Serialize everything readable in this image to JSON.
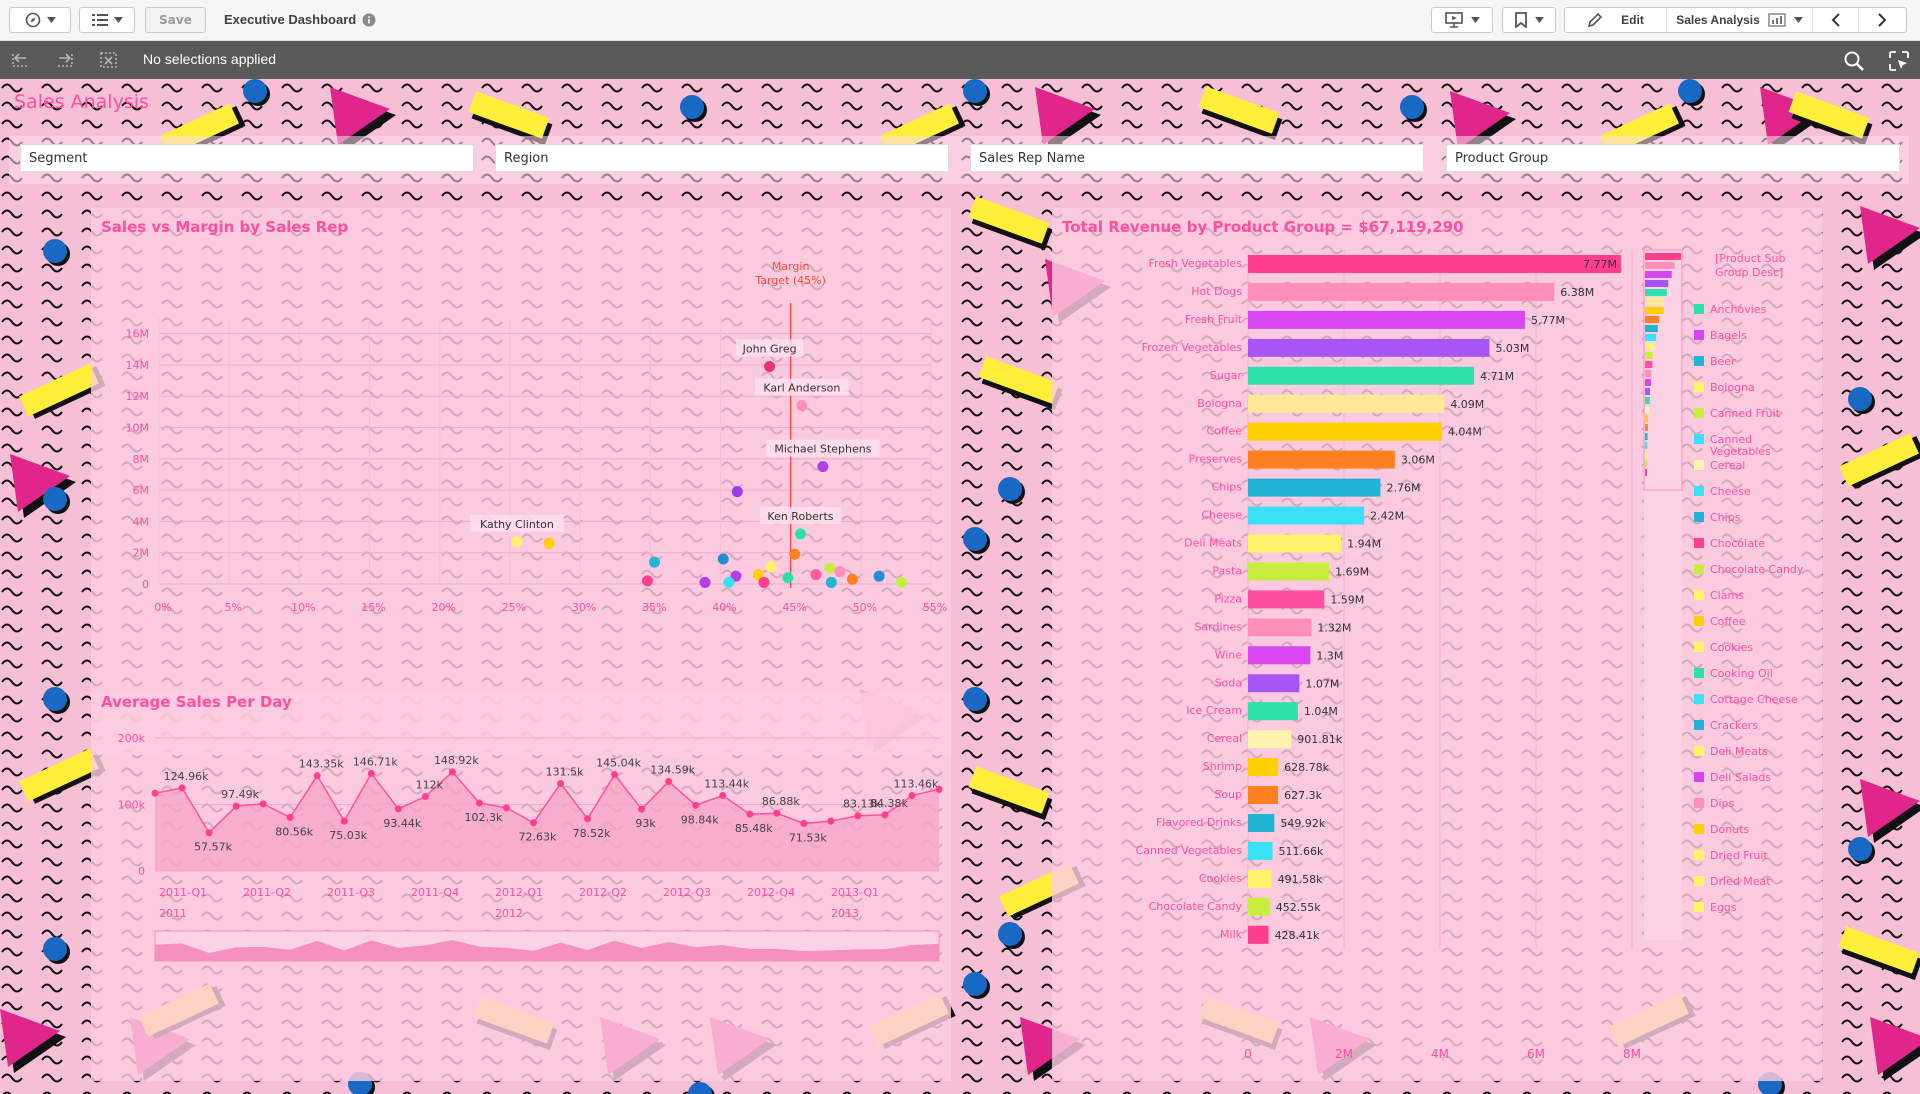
{
  "toolbar": {
    "save_label": "Save",
    "app_title": "Executive Dashboard",
    "edit_label": "Edit",
    "sheet_name": "Sales Analysis"
  },
  "selections": {
    "text": "No selections applied"
  },
  "sheet": {
    "title": "Sales Analysis",
    "filters": [
      "Segment",
      "Region",
      "Sales Rep Name",
      "Product Group"
    ]
  },
  "colors": {
    "accent": "#ff4fa0",
    "selbar": "#595959",
    "background": "#f9c6dc"
  },
  "chart_data": [
    {
      "type": "scatter",
      "title": "Sales vs Margin by Sales Rep",
      "xlabel": "",
      "ylabel": "",
      "xlim": [
        0,
        55
      ],
      "ylim": [
        0,
        17
      ],
      "x_ticks": [
        "0%",
        "5%",
        "10%",
        "15%",
        "20%",
        "25%",
        "30%",
        "35%",
        "40%",
        "45%",
        "50%",
        "55%"
      ],
      "y_ticks": [
        "0",
        "2M",
        "4M",
        "6M",
        "8M",
        "10M",
        "12M",
        "14M",
        "16M"
      ],
      "reference_line": {
        "label": "Margin Target (45%)",
        "x": 45
      },
      "points": [
        {
          "label": "John Greg",
          "x": 43.5,
          "y": 13.9,
          "color": "#e8336d"
        },
        {
          "label": "Karl Anderson",
          "x": 45.8,
          "y": 11.4,
          "color": "#ff8fb8"
        },
        {
          "label": "Michael Stephens",
          "x": 47.3,
          "y": 7.5,
          "color": "#b23fe6"
        },
        {
          "label": "",
          "x": 41.2,
          "y": 5.9,
          "color": "#9b3de8"
        },
        {
          "label": "Ken Roberts",
          "x": 45.7,
          "y": 3.2,
          "color": "#2de2a8"
        },
        {
          "label": "Kathy Clinton",
          "x": 25.5,
          "y": 2.7,
          "color": "#fff36b"
        },
        {
          "label": "",
          "x": 27.8,
          "y": 2.6,
          "color": "#ffcf00"
        },
        {
          "label": "",
          "x": 35.3,
          "y": 1.4,
          "color": "#1fb4d6"
        },
        {
          "label": "",
          "x": 40.2,
          "y": 1.6,
          "color": "#1e8fd0"
        },
        {
          "label": "",
          "x": 45.3,
          "y": 1.9,
          "color": "#ff8020"
        },
        {
          "label": "",
          "x": 43.6,
          "y": 1.1,
          "color": "#fff36b"
        },
        {
          "label": "",
          "x": 42.7,
          "y": 0.6,
          "color": "#ffcf00"
        },
        {
          "label": "",
          "x": 47.8,
          "y": 1.0,
          "color": "#c7ee3e"
        },
        {
          "label": "",
          "x": 48.5,
          "y": 0.8,
          "color": "#ff8fb8"
        },
        {
          "label": "",
          "x": 46.8,
          "y": 0.6,
          "color": "#ff5aa5"
        },
        {
          "label": "",
          "x": 49.4,
          "y": 0.3,
          "color": "#ff8020"
        },
        {
          "label": "",
          "x": 51.3,
          "y": 0.5,
          "color": "#1e8fd0"
        },
        {
          "label": "",
          "x": 41.1,
          "y": 0.5,
          "color": "#b23fe6"
        },
        {
          "label": "",
          "x": 44.8,
          "y": 0.4,
          "color": "#2de2a8"
        },
        {
          "label": "",
          "x": 34.8,
          "y": 0.2,
          "color": "#ff3f8e"
        },
        {
          "label": "",
          "x": 38.9,
          "y": 0.1,
          "color": "#b23fe6"
        },
        {
          "label": "",
          "x": 43.1,
          "y": 0.1,
          "color": "#ff3f8e"
        },
        {
          "label": "",
          "x": 40.6,
          "y": 0.1,
          "color": "#3ce0f5"
        },
        {
          "label": "",
          "x": 47.9,
          "y": 0.1,
          "color": "#1fb4d6"
        },
        {
          "label": "",
          "x": 52.9,
          "y": 0.1,
          "color": "#c7ee3e"
        }
      ]
    },
    {
      "type": "area",
      "title": "Average Sales Per Day",
      "xlabel": "",
      "ylabel": "",
      "ylim": [
        0,
        200000
      ],
      "y_ticks": [
        "0",
        "100k",
        "200k"
      ],
      "x_labels": [
        "2011-Q1",
        "2011-Q2",
        "2011-Q3",
        "2011-Q4",
        "2012-Q1",
        "2012-Q2",
        "2012-Q3",
        "2012-Q4",
        "2013-Q1"
      ],
      "year_labels": [
        "2011",
        "2012",
        "2013"
      ],
      "values": [
        117000,
        124960,
        57570,
        97490,
        101000,
        80560,
        143350,
        75030,
        146710,
        93440,
        112000,
        148920,
        102300,
        95000,
        72630,
        131500,
        78520,
        145040,
        93000,
        134590,
        98840,
        113440,
        85480,
        86880,
        71530,
        75000,
        83130,
        84380,
        113460,
        123000
      ],
      "data_labels": [
        "",
        "124.96k",
        "57.57k",
        "97.49k",
        "",
        "80.56k",
        "143.35k",
        "75.03k",
        "146.71k",
        "93.44k",
        "112k",
        "148.92k",
        "102.3k",
        "",
        "72.63k",
        "131.5k",
        "78.52k",
        "145.04k",
        "93k",
        "134.59k",
        "98.84k",
        "113.44k",
        "85.48k",
        "86.88k",
        "71.53k",
        "",
        "83.13k",
        "84.38k",
        "113.46k",
        ""
      ]
    },
    {
      "type": "bar",
      "orientation": "horizontal",
      "title": "Total Revenue by Product Group = $67,119,290",
      "xlabel": "",
      "ylabel": "",
      "xlim": [
        0,
        8000000
      ],
      "x_ticks": [
        "0",
        "2M",
        "4M",
        "6M",
        "8M"
      ],
      "categories": [
        "Fresh Vegetables",
        "Hot Dogs",
        "Fresh Fruit",
        "Frozen Vegetables",
        "Sugar",
        "Bologna",
        "Coffee",
        "Preserves",
        "Chips",
        "Cheese",
        "Deli Meats",
        "Pasta",
        "Pizza",
        "Sardines",
        "Wine",
        "Soda",
        "Ice Cream",
        "Cereal",
        "Shrimp",
        "Soup",
        "Flavored Drinks",
        "Canned Vegetables",
        "Cookies",
        "Chocolate Candy",
        "Milk"
      ],
      "values": [
        7770000,
        6380000,
        5770000,
        5030000,
        4710000,
        4090000,
        4040000,
        3060000,
        2760000,
        2420000,
        1940000,
        1690000,
        1590000,
        1320000,
        1300000,
        1070000,
        1040000,
        901810,
        628780,
        627300,
        549920,
        511660,
        491580,
        452550,
        428410
      ],
      "value_labels": [
        "7.77M",
        "6.38M",
        "5.77M",
        "5.03M",
        "4.71M",
        "4.09M",
        "4.04M",
        "3.06M",
        "2.76M",
        "2.42M",
        "1.94M",
        "1.69M",
        "1.59M",
        "1.32M",
        "1.3M",
        "1.07M",
        "1.04M",
        "901.81k",
        "628.78k",
        "627.3k",
        "549.92k",
        "511.66k",
        "491.58k",
        "452.55k",
        "428.41k"
      ],
      "colors": [
        "#ff3f8e",
        "#ff8fb8",
        "#d946ef",
        "#a855f7",
        "#2de2a8",
        "#ffe999",
        "#ffcf00",
        "#ff8020",
        "#1fb4d6",
        "#3ce0f5",
        "#fff36b",
        "#c7ee3e",
        "#ff4fa0",
        "#ff8fb8",
        "#d946ef",
        "#a855f7",
        "#2de2a8",
        "#fff5b0",
        "#ffcf00",
        "#ff8020",
        "#1fb4d6",
        "#3ce0f5",
        "#fff36b",
        "#c7ee3e",
        "#ff3f8e"
      ],
      "legend": {
        "title": "[Product Sub Group Desc]",
        "items": [
          {
            "label": "Anchovies",
            "color": "#2de2a8"
          },
          {
            "label": "Bagels",
            "color": "#d946ef"
          },
          {
            "label": "Beer",
            "color": "#1fb4d6"
          },
          {
            "label": "Bologna",
            "color": "#fff36b"
          },
          {
            "label": "Canned Fruit",
            "color": "#c7ee3e"
          },
          {
            "label": "Canned Vegetables",
            "color": "#3ce0f5"
          },
          {
            "label": "Cereal",
            "color": "#fff5b0"
          },
          {
            "label": "Cheese",
            "color": "#3ce0f5"
          },
          {
            "label": "Chips",
            "color": "#1fb4d6"
          },
          {
            "label": "Chocolate",
            "color": "#ff3f8e"
          },
          {
            "label": "Chocolate Candy",
            "color": "#c7ee3e"
          },
          {
            "label": "Clams",
            "color": "#fff36b"
          },
          {
            "label": "Coffee",
            "color": "#ffcf00"
          },
          {
            "label": "Cookies",
            "color": "#fff36b"
          },
          {
            "label": "Cooking Oil",
            "color": "#2de2a8"
          },
          {
            "label": "Cottage Cheese",
            "color": "#3ce0f5"
          },
          {
            "label": "Crackers",
            "color": "#1fb4d6"
          },
          {
            "label": "Deli Meats",
            "color": "#fff36b"
          },
          {
            "label": "Deli Salads",
            "color": "#d946ef"
          },
          {
            "label": "Dips",
            "color": "#ff8fb8"
          },
          {
            "label": "Donuts",
            "color": "#ffcf00"
          },
          {
            "label": "Dried Fruit",
            "color": "#fff36b"
          },
          {
            "label": "Dried Meat",
            "color": "#fff36b"
          },
          {
            "label": "Eggs",
            "color": "#fff36b"
          }
        ]
      }
    }
  ]
}
